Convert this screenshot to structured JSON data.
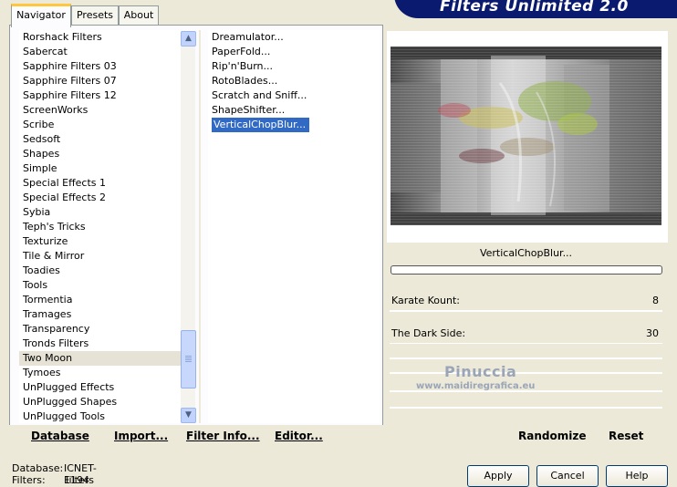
{
  "app": {
    "title": "Filters Unlimited 2.0"
  },
  "tabs": [
    {
      "label": "Navigator",
      "active": true
    },
    {
      "label": "Presets",
      "active": false
    },
    {
      "label": "About",
      "active": false
    }
  ],
  "categories": {
    "items": [
      "Rorshack Filters",
      "Sabercat",
      "Sapphire Filters 03",
      "Sapphire Filters 07",
      "Sapphire Filters 12",
      "ScreenWorks",
      "Scribe",
      "Sedsoft",
      "Shapes",
      "Simple",
      "Special Effects 1",
      "Special Effects 2",
      "Sybia",
      "Teph's Tricks",
      "Texturize",
      "Tile & Mirror",
      "Toadies",
      "Tools",
      "Tormentia",
      "Tramages",
      "Transparency",
      "Tronds Filters",
      "Two Moon",
      "Tymoes",
      "UnPlugged Effects",
      "UnPlugged Shapes",
      "UnPlugged Tools"
    ],
    "selected": "Two Moon"
  },
  "filters": {
    "items": [
      "Dreamulator...",
      "PaperFold...",
      "Rip'n'Burn...",
      "RotoBlades...",
      "Scratch and Sniff...",
      "ShapeShifter...",
      "VerticalChopBlur..."
    ],
    "selected": "VerticalChopBlur..."
  },
  "nav_buttons": {
    "database": "Database",
    "import": "Import...",
    "filter_info": "Filter Info...",
    "editor": "Editor..."
  },
  "preview": {
    "filter_name": "VerticalChopBlur...",
    "progress": 0
  },
  "params": [
    {
      "label": "Karate Kount:",
      "value": "8"
    },
    {
      "label": "The Dark Side:",
      "value": "30"
    }
  ],
  "right_buttons": {
    "randomize": "Randomize",
    "reset": "Reset"
  },
  "watermark": {
    "name": "Pinuccia",
    "url": "www.maidiregrafica.eu"
  },
  "status": {
    "database_label": "Database:",
    "database_value": "ICNET-Filters",
    "filters_label": "Filters:",
    "filters_value": "1194"
  },
  "dialog_buttons": {
    "apply": "Apply",
    "cancel": "Cancel",
    "help": "Help"
  }
}
